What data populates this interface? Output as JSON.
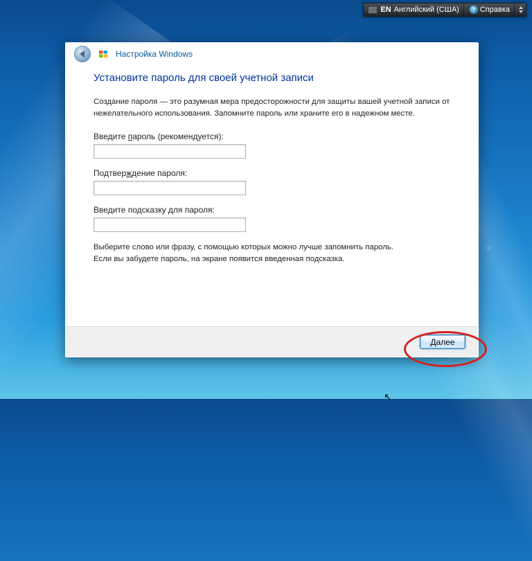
{
  "topbar": {
    "lang_code": "EN",
    "lang_name": "Английский (США)",
    "help_label": "Справка"
  },
  "window": {
    "header_title": "Настройка Windows"
  },
  "page": {
    "heading": "Установите пароль для своей учетной записи",
    "description": "Создание пароля — это разумная мера предосторожности для защиты вашей учетной записи от нежелательного использования. Запомните пароль или храните его в надежном месте.",
    "password_label_pre": "Введите ",
    "password_label_u": "п",
    "password_label_post": "ароль (рекомендуется):",
    "password_value": "",
    "confirm_label_pre": "Подтвер",
    "confirm_label_u": "ж",
    "confirm_label_post": "дение пароля:",
    "confirm_value": "",
    "hint_label": "Введите подсказку для пароля:",
    "hint_value": "",
    "help_text1": "Выберите слово или фразу, с помощью которых можно лучше запомнить пароль.",
    "help_text2": "Если вы забудете пароль, на экране появится введенная подсказка."
  },
  "footer": {
    "next_label": "Далее"
  }
}
